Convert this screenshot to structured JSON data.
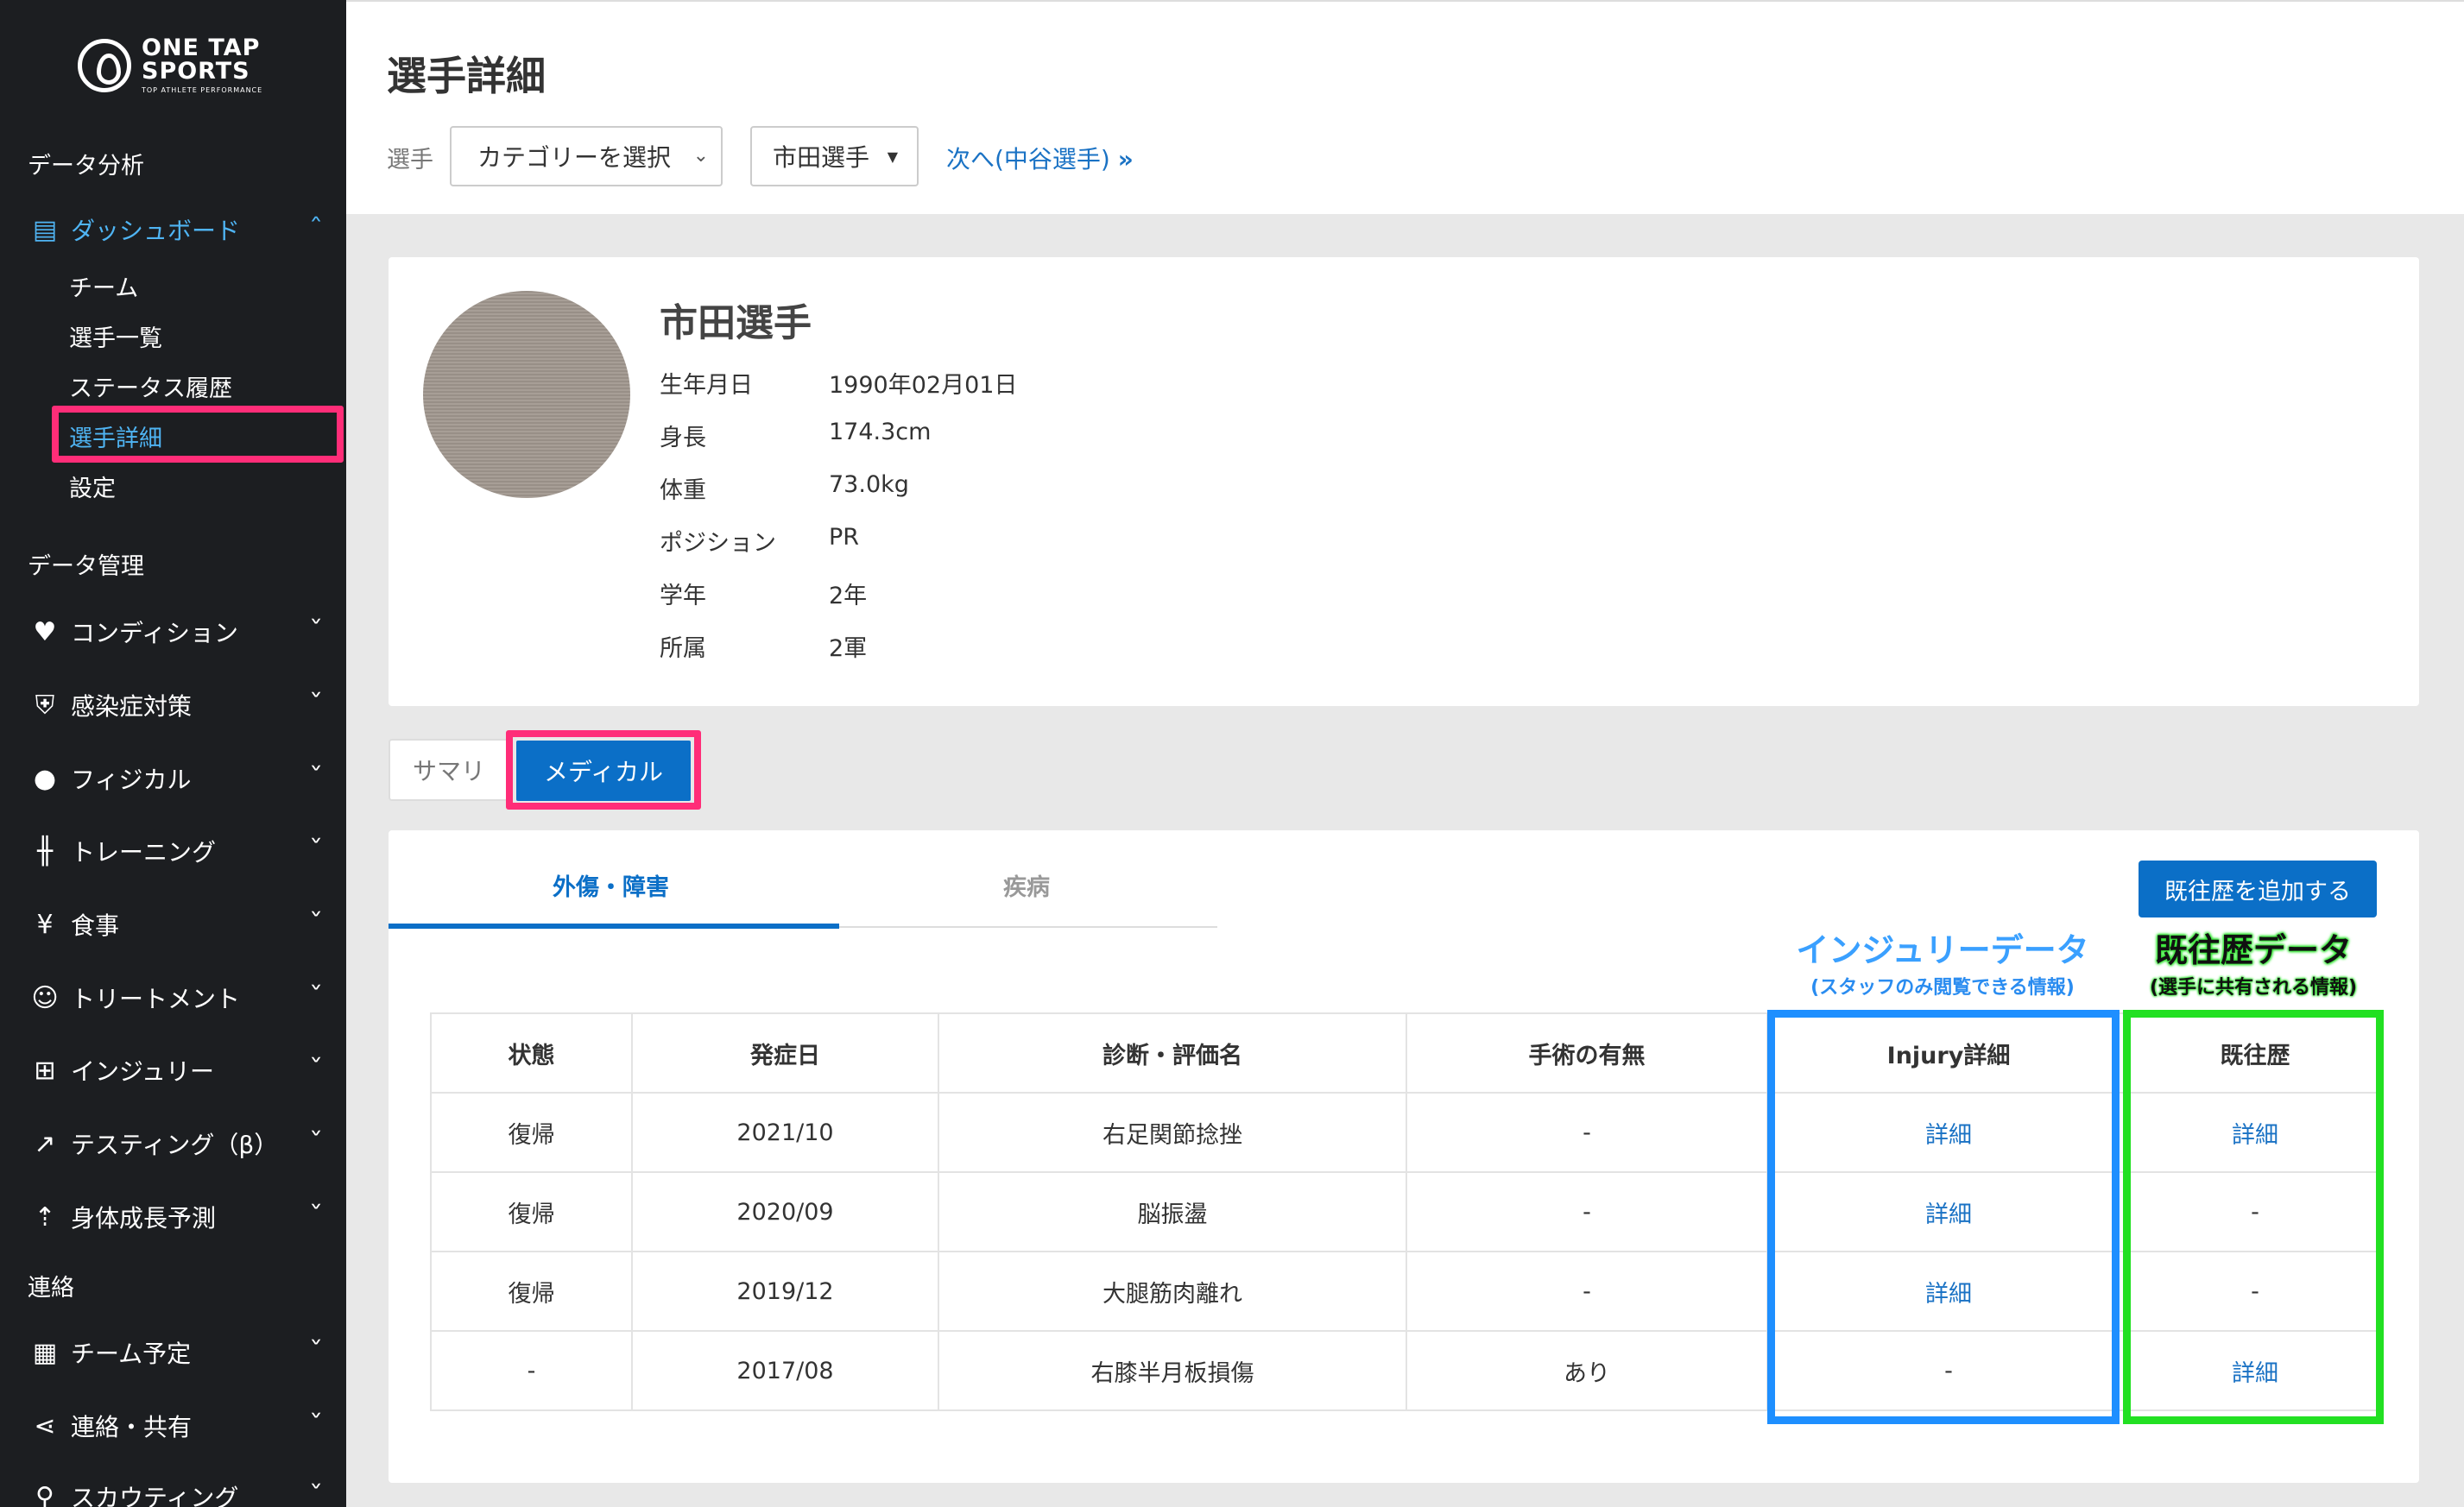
{
  "brand": {
    "line1": "ONE TAP",
    "line2": "SPORTS",
    "tagline": "TOP ATHLETE PERFORMANCE"
  },
  "sidebar": {
    "section_analysis": "データ分析",
    "dashboard": "ダッシュボード",
    "dashboard_sub": [
      "チーム",
      "選手一覧",
      "ステータス履歴",
      "選手詳細",
      "設定"
    ],
    "section_manage": "データ管理",
    "manage_items": [
      "コンディション",
      "感染症対策",
      "フィジカル",
      "トレーニング",
      "食事",
      "トリートメント",
      "インジュリー",
      "テスティング（β）",
      "身体成長予測"
    ],
    "section_contact": "連絡",
    "contact_items": [
      "チーム予定",
      "連絡・共有",
      "スカウティング"
    ]
  },
  "header": {
    "title": "選手詳細",
    "player_label": "選手",
    "category_placeholder": "カテゴリーを選択",
    "player_selected": "市田選手",
    "next_link": "次へ(中谷選手)"
  },
  "profile": {
    "name": "市田選手",
    "fields": [
      {
        "label": "生年月日",
        "value": "1990年02月01日"
      },
      {
        "label": "身長",
        "value": "174.3cm"
      },
      {
        "label": "体重",
        "value": "73.0kg"
      },
      {
        "label": "ポジション",
        "value": "PR"
      },
      {
        "label": "学年",
        "value": "2年"
      },
      {
        "label": "所属",
        "value": "2軍"
      }
    ]
  },
  "tabs": {
    "summary": "サマリ",
    "medical": "メディカル"
  },
  "subtabs": {
    "injury": "外傷・障害",
    "illness": "疾病"
  },
  "add_button": "既往歴を追加する",
  "annotations": {
    "blue_title": "インジュリーデータ",
    "blue_sub": "(スタッフのみ閲覧できる情報)",
    "green_title": "既往歴データ",
    "green_sub": "(選手に共有される情報)"
  },
  "table": {
    "headers": [
      "状態",
      "発症日",
      "診断・評価名",
      "手術の有無",
      "Injury詳細",
      "既往歴"
    ],
    "rows": [
      [
        "復帰",
        "2021/10",
        "右足関節捻挫",
        "-",
        "詳細",
        "詳細"
      ],
      [
        "復帰",
        "2020/09",
        "脳振盪",
        "-",
        "詳細",
        "-"
      ],
      [
        "復帰",
        "2019/12",
        "大腿筋肉離れ",
        "-",
        "詳細",
        "-"
      ],
      [
        "-",
        "2017/08",
        "右膝半月板損傷",
        "あり",
        "-",
        "詳細"
      ]
    ]
  }
}
